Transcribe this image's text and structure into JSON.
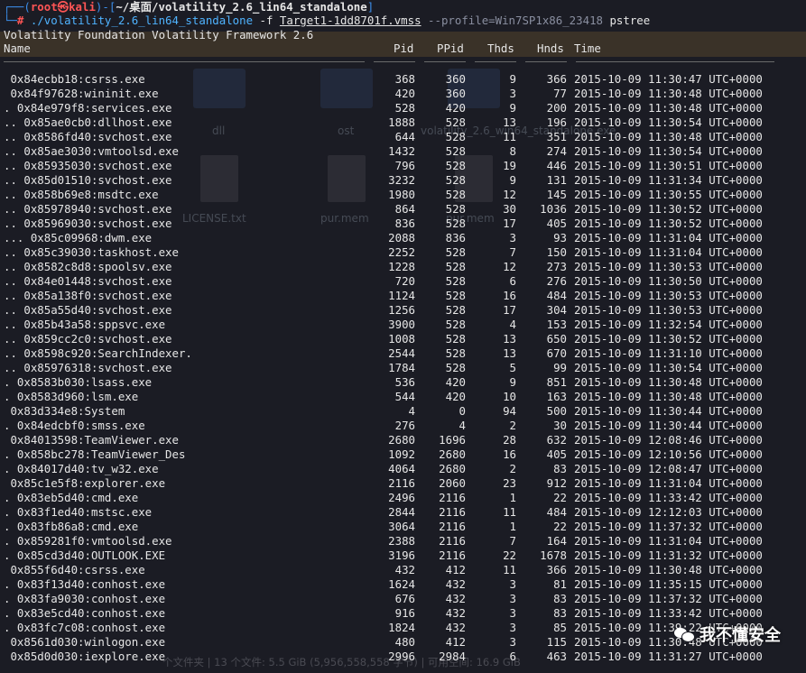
{
  "prompt": {
    "user": "root㉿kali",
    "path": "~/桌面/volatility_2.6_lin64_standalone",
    "command": "./volatility_2.6_lin64_standalone",
    "flag_f": "-f",
    "file": "Target1-1dd8701f.vmss",
    "profile": "--profile=Win7SP1x86_23418",
    "plugin": "pstree"
  },
  "banner": "Volatility Foundation Volatility Framework 2.6",
  "headers": {
    "name": "Name",
    "pid": "Pid",
    "ppid": "PPid",
    "thds": "Thds",
    "hnds": "Hnds",
    "time": "Time"
  },
  "rows": [
    {
      "name": " 0x84ecbb18:csrss.exe",
      "pid": "368",
      "ppid": "360",
      "thds": "9",
      "hnds": "366",
      "time": "2015-10-09 11:30:47 UTC+0000"
    },
    {
      "name": " 0x84f97628:wininit.exe",
      "pid": "420",
      "ppid": "360",
      "thds": "3",
      "hnds": "77",
      "time": "2015-10-09 11:30:48 UTC+0000"
    },
    {
      "name": ". 0x84e979f8:services.exe",
      "pid": "528",
      "ppid": "420",
      "thds": "9",
      "hnds": "200",
      "time": "2015-10-09 11:30:48 UTC+0000"
    },
    {
      "name": ".. 0x85ae0cb0:dllhost.exe",
      "pid": "1888",
      "ppid": "528",
      "thds": "13",
      "hnds": "196",
      "time": "2015-10-09 11:30:54 UTC+0000"
    },
    {
      "name": ".. 0x8586fd40:svchost.exe",
      "pid": "644",
      "ppid": "528",
      "thds": "11",
      "hnds": "351",
      "time": "2015-10-09 11:30:48 UTC+0000"
    },
    {
      "name": ".. 0x85ae3030:vmtoolsd.exe",
      "pid": "1432",
      "ppid": "528",
      "thds": "8",
      "hnds": "274",
      "time": "2015-10-09 11:30:54 UTC+0000"
    },
    {
      "name": ".. 0x85935030:svchost.exe",
      "pid": "796",
      "ppid": "528",
      "thds": "19",
      "hnds": "446",
      "time": "2015-10-09 11:30:51 UTC+0000"
    },
    {
      "name": ".. 0x85d01510:svchost.exe",
      "pid": "3232",
      "ppid": "528",
      "thds": "9",
      "hnds": "131",
      "time": "2015-10-09 11:31:34 UTC+0000"
    },
    {
      "name": ".. 0x858b69e8:msdtc.exe",
      "pid": "1980",
      "ppid": "528",
      "thds": "12",
      "hnds": "145",
      "time": "2015-10-09 11:30:55 UTC+0000"
    },
    {
      "name": ".. 0x85978940:svchost.exe",
      "pid": "864",
      "ppid": "528",
      "thds": "30",
      "hnds": "1036",
      "time": "2015-10-09 11:30:52 UTC+0000"
    },
    {
      "name": ".. 0x85969030:svchost.exe",
      "pid": "836",
      "ppid": "528",
      "thds": "17",
      "hnds": "405",
      "time": "2015-10-09 11:30:52 UTC+0000"
    },
    {
      "name": "... 0x85c09968:dwm.exe",
      "pid": "2088",
      "ppid": "836",
      "thds": "3",
      "hnds": "93",
      "time": "2015-10-09 11:31:04 UTC+0000"
    },
    {
      "name": ".. 0x85c39030:taskhost.exe",
      "pid": "2252",
      "ppid": "528",
      "thds": "7",
      "hnds": "150",
      "time": "2015-10-09 11:31:04 UTC+0000"
    },
    {
      "name": ".. 0x8582c8d8:spoolsv.exe",
      "pid": "1228",
      "ppid": "528",
      "thds": "12",
      "hnds": "273",
      "time": "2015-10-09 11:30:53 UTC+0000"
    },
    {
      "name": ".. 0x84e01448:svchost.exe",
      "pid": "720",
      "ppid": "528",
      "thds": "6",
      "hnds": "276",
      "time": "2015-10-09 11:30:50 UTC+0000"
    },
    {
      "name": ".. 0x85a138f0:svchost.exe",
      "pid": "1124",
      "ppid": "528",
      "thds": "16",
      "hnds": "484",
      "time": "2015-10-09 11:30:53 UTC+0000"
    },
    {
      "name": ".. 0x85a55d40:svchost.exe",
      "pid": "1256",
      "ppid": "528",
      "thds": "17",
      "hnds": "304",
      "time": "2015-10-09 11:30:53 UTC+0000"
    },
    {
      "name": ".. 0x85b43a58:sppsvc.exe",
      "pid": "3900",
      "ppid": "528",
      "thds": "4",
      "hnds": "153",
      "time": "2015-10-09 11:32:54 UTC+0000"
    },
    {
      "name": ".. 0x859cc2c0:svchost.exe",
      "pid": "1008",
      "ppid": "528",
      "thds": "13",
      "hnds": "650",
      "time": "2015-10-09 11:30:52 UTC+0000"
    },
    {
      "name": ".. 0x8598c920:SearchIndexer.",
      "pid": "2544",
      "ppid": "528",
      "thds": "13",
      "hnds": "670",
      "time": "2015-10-09 11:31:10 UTC+0000"
    },
    {
      "name": ".. 0x85976318:svchost.exe",
      "pid": "1784",
      "ppid": "528",
      "thds": "5",
      "hnds": "99",
      "time": "2015-10-09 11:30:54 UTC+0000"
    },
    {
      "name": ". 0x8583b030:lsass.exe",
      "pid": "536",
      "ppid": "420",
      "thds": "9",
      "hnds": "851",
      "time": "2015-10-09 11:30:48 UTC+0000"
    },
    {
      "name": ". 0x8583d960:lsm.exe",
      "pid": "544",
      "ppid": "420",
      "thds": "10",
      "hnds": "163",
      "time": "2015-10-09 11:30:48 UTC+0000"
    },
    {
      "name": " 0x83d334e8:System",
      "pid": "4",
      "ppid": "0",
      "thds": "94",
      "hnds": "500",
      "time": "2015-10-09 11:30:44 UTC+0000"
    },
    {
      "name": ". 0x84edcbf0:smss.exe",
      "pid": "276",
      "ppid": "4",
      "thds": "2",
      "hnds": "30",
      "time": "2015-10-09 11:30:44 UTC+0000"
    },
    {
      "name": " 0x84013598:TeamViewer.exe",
      "pid": "2680",
      "ppid": "1696",
      "thds": "28",
      "hnds": "632",
      "time": "2015-10-09 12:08:46 UTC+0000"
    },
    {
      "name": ". 0x858bc278:TeamViewer_Des",
      "pid": "1092",
      "ppid": "2680",
      "thds": "16",
      "hnds": "405",
      "time": "2015-10-09 12:10:56 UTC+0000"
    },
    {
      "name": ". 0x84017d40:tv_w32.exe",
      "pid": "4064",
      "ppid": "2680",
      "thds": "2",
      "hnds": "83",
      "time": "2015-10-09 12:08:47 UTC+0000"
    },
    {
      "name": " 0x85c1e5f8:explorer.exe",
      "pid": "2116",
      "ppid": "2060",
      "thds": "23",
      "hnds": "912",
      "time": "2015-10-09 11:31:04 UTC+0000"
    },
    {
      "name": ". 0x83eb5d40:cmd.exe",
      "pid": "2496",
      "ppid": "2116",
      "thds": "1",
      "hnds": "22",
      "time": "2015-10-09 11:33:42 UTC+0000"
    },
    {
      "name": ". 0x83f1ed40:mstsc.exe",
      "pid": "2844",
      "ppid": "2116",
      "thds": "11",
      "hnds": "484",
      "time": "2015-10-09 12:12:03 UTC+0000"
    },
    {
      "name": ". 0x83fb86a8:cmd.exe",
      "pid": "3064",
      "ppid": "2116",
      "thds": "1",
      "hnds": "22",
      "time": "2015-10-09 11:37:32 UTC+0000"
    },
    {
      "name": ". 0x859281f0:vmtoolsd.exe",
      "pid": "2388",
      "ppid": "2116",
      "thds": "7",
      "hnds": "164",
      "time": "2015-10-09 11:31:04 UTC+0000"
    },
    {
      "name": ". 0x85cd3d40:OUTLOOK.EXE",
      "pid": "3196",
      "ppid": "2116",
      "thds": "22",
      "hnds": "1678",
      "time": "2015-10-09 11:31:32 UTC+0000"
    },
    {
      "name": " 0x855f6d40:csrss.exe",
      "pid": "432",
      "ppid": "412",
      "thds": "11",
      "hnds": "366",
      "time": "2015-10-09 11:30:48 UTC+0000"
    },
    {
      "name": ". 0x83f13d40:conhost.exe",
      "pid": "1624",
      "ppid": "432",
      "thds": "3",
      "hnds": "81",
      "time": "2015-10-09 11:35:15 UTC+0000"
    },
    {
      "name": ". 0x83fa9030:conhost.exe",
      "pid": "676",
      "ppid": "432",
      "thds": "3",
      "hnds": "83",
      "time": "2015-10-09 11:37:32 UTC+0000"
    },
    {
      "name": ". 0x83e5cd40:conhost.exe",
      "pid": "916",
      "ppid": "432",
      "thds": "3",
      "hnds": "83",
      "time": "2015-10-09 11:33:42 UTC+0000"
    },
    {
      "name": ". 0x83fc7c08:conhost.exe",
      "pid": "1824",
      "ppid": "432",
      "thds": "3",
      "hnds": "85",
      "time": "2015-10-09 11:39:22 UTC+0000"
    },
    {
      "name": " 0x8561d030:winlogon.exe",
      "pid": "480",
      "ppid": "412",
      "thds": "3",
      "hnds": "115",
      "time": "2015-10-09 11:30:48 UTC+0000"
    },
    {
      "name": " 0x85d0d030:iexplore.exe",
      "pid": "2996",
      "ppid": "2984",
      "thds": "6",
      "hnds": "463",
      "time": "2015-10-09 11:31:27 UTC+0000"
    }
  ],
  "ghost_desktop": {
    "labels": [
      "dll",
      "ost",
      "volatility_2.6_win64_standalone.exe",
      "LICENSE.txt",
      "pur.mem",
      "pur.mem"
    ],
    "footer": "个文件夹 | 13 个文件: 5.5 GiB (5,956,558,558 字节) | 可用空间: 16.9 GiB"
  },
  "watermark": "我不懂安全",
  "colors": {
    "background": "#1b1c24",
    "prompt_red": "#ff5555",
    "prompt_blue": "#3b8eea",
    "command_blue": "#4fb3ff",
    "text": "#e6e6e6"
  }
}
